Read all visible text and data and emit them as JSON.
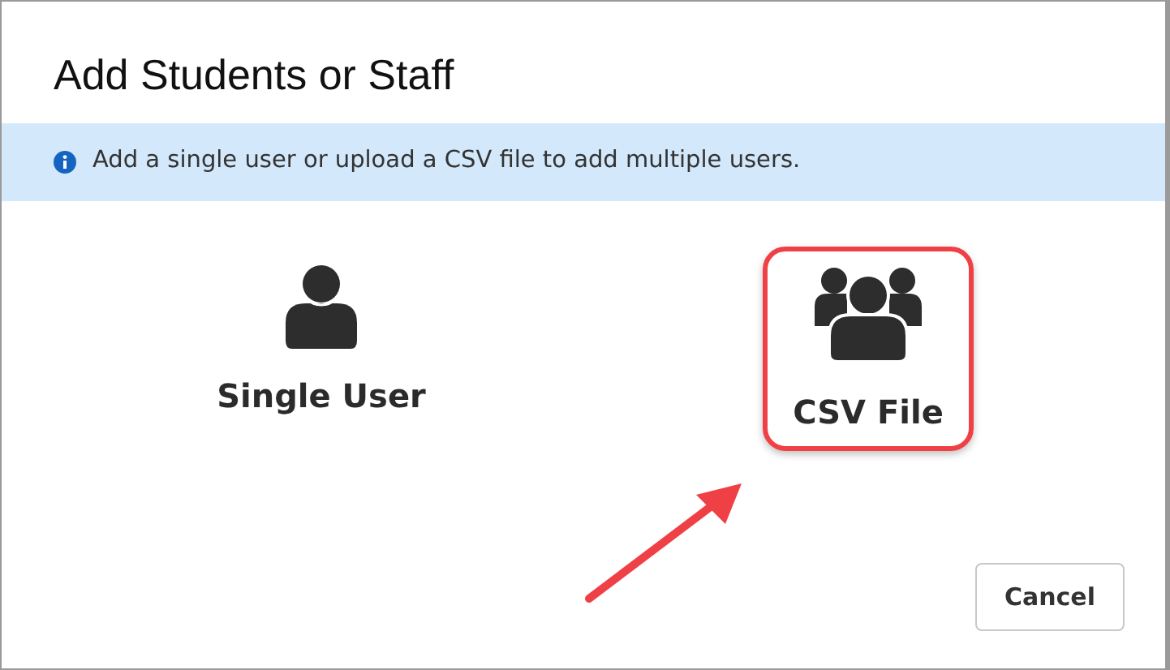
{
  "dialog": {
    "title": "Add Students or Staff"
  },
  "info": {
    "text": "Add a single user or upload a CSV file to add multiple users."
  },
  "options": [
    {
      "kind": "single",
      "label": "Single User",
      "highlighted": false
    },
    {
      "kind": "group",
      "label": "CSV File",
      "highlighted": true
    }
  ],
  "annotation": {
    "kind": "arrow"
  },
  "buttons": [
    {
      "label": "Cancel"
    }
  ]
}
